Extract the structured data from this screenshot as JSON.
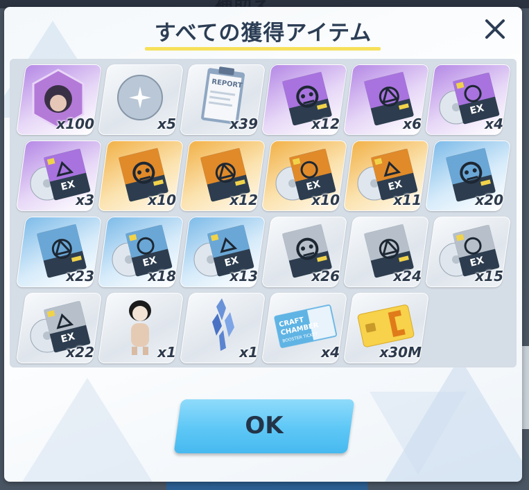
{
  "background": {
    "top_text": "補助え"
  },
  "dialog": {
    "title": "すべての獲得アイテム",
    "ok_label": "OK"
  },
  "items": [
    {
      "name": "student-eleph-portrait",
      "quantity": "x100",
      "rarity": "purple"
    },
    {
      "name": "crystal-orb",
      "quantity": "x5",
      "rarity": "gray"
    },
    {
      "name": "report-clipboard",
      "quantity": "x39",
      "rarity": "gray"
    },
    {
      "name": "arius-note-purple",
      "quantity": "x12",
      "rarity": "purple"
    },
    {
      "name": "trinity-note-purple",
      "quantity": "x6",
      "rarity": "purple"
    },
    {
      "name": "ex-arius-disc-purple",
      "quantity": "x4",
      "rarity": "purple"
    },
    {
      "name": "ex-trinity-disc-purple",
      "quantity": "x3",
      "rarity": "purple"
    },
    {
      "name": "arius-note-gold",
      "quantity": "x10",
      "rarity": "gold"
    },
    {
      "name": "trinity-note-gold",
      "quantity": "x12",
      "rarity": "gold"
    },
    {
      "name": "ex-arius-disc-gold",
      "quantity": "x10",
      "rarity": "gold"
    },
    {
      "name": "ex-trinity-disc-gold",
      "quantity": "x11",
      "rarity": "gold"
    },
    {
      "name": "arius-note-blue",
      "quantity": "x20",
      "rarity": "blue"
    },
    {
      "name": "trinity-note-blue",
      "quantity": "x23",
      "rarity": "blue"
    },
    {
      "name": "ex-arius-disc-blue",
      "quantity": "x18",
      "rarity": "blue"
    },
    {
      "name": "ex-trinity-disc-blue",
      "quantity": "x13",
      "rarity": "blue"
    },
    {
      "name": "arius-note-gray",
      "quantity": "x26",
      "rarity": "gray"
    },
    {
      "name": "trinity-note-gray",
      "quantity": "x24",
      "rarity": "gray"
    },
    {
      "name": "ex-arius-disc-gray",
      "quantity": "x15",
      "rarity": "gray"
    },
    {
      "name": "ex-trinity-disc-gray",
      "quantity": "x22",
      "rarity": "gray"
    },
    {
      "name": "doll-figure",
      "quantity": "x1",
      "rarity": "gray"
    },
    {
      "name": "blue-crystal-shards",
      "quantity": "x1",
      "rarity": "gray"
    },
    {
      "name": "craft-chamber-ticket",
      "quantity": "x4",
      "rarity": "gray",
      "text_lines": [
        "CRAFT",
        "CHAMBER",
        "BOOSTER TICKET"
      ]
    },
    {
      "name": "credit-card",
      "quantity": "x30M",
      "rarity": "gray"
    }
  ],
  "colors": {
    "title": "#2c3e55",
    "underline": "#f7e05a",
    "ok_button": "#5dc7f6",
    "purple": "#b68ae6",
    "gold": "#f2b24a",
    "blue": "#7fbce9"
  }
}
